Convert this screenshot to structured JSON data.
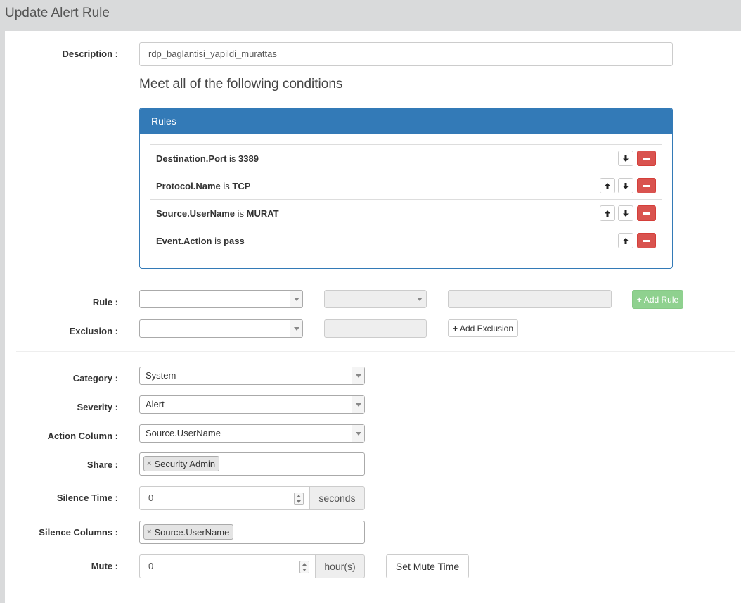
{
  "page": {
    "title": "Update Alert Rule"
  },
  "form": {
    "description_label": "Description :",
    "description_value": "rdp_baglantisi_yapildi_murattas",
    "conditions_heading": "Meet all of the following conditions",
    "rules_panel_title": "Rules",
    "rules": [
      {
        "field": "Destination.Port",
        "op": "is",
        "value": "3389"
      },
      {
        "field": "Protocol.Name",
        "op": "is",
        "value": "TCP"
      },
      {
        "field": "Source.UserName",
        "op": "is",
        "value": "MURAT"
      },
      {
        "field": "Event.Action",
        "op": "is",
        "value": "pass"
      }
    ],
    "rule_label": "Rule :",
    "exclusion_label": "Exclusion :",
    "add_rule_button": "Add Rule",
    "add_exclusion_button": "Add Exclusion",
    "category_label": "Category :",
    "category_value": "System",
    "severity_label": "Severity :",
    "severity_value": "Alert",
    "action_column_label": "Action Column :",
    "action_column_value": "Source.UserName",
    "share_label": "Share :",
    "share_tag": "Security Admin",
    "silence_time_label": "Silence Time :",
    "silence_time_value": "0",
    "silence_time_unit": "seconds",
    "silence_columns_label": "Silence Columns :",
    "silence_columns_tag": "Source.UserName",
    "mute_label": "Mute :",
    "mute_value": "0",
    "mute_unit": "hour(s)",
    "set_mute_button": "Set Mute Time"
  },
  "icons": {
    "up": "arrow-up-icon",
    "down": "arrow-down-icon",
    "remove": "minus-icon",
    "plus": "plus-icon",
    "tag_remove": "close-icon"
  },
  "colors": {
    "primary": "#337ab7",
    "danger": "#d9534f",
    "success_disabled": "#8fd18f"
  }
}
